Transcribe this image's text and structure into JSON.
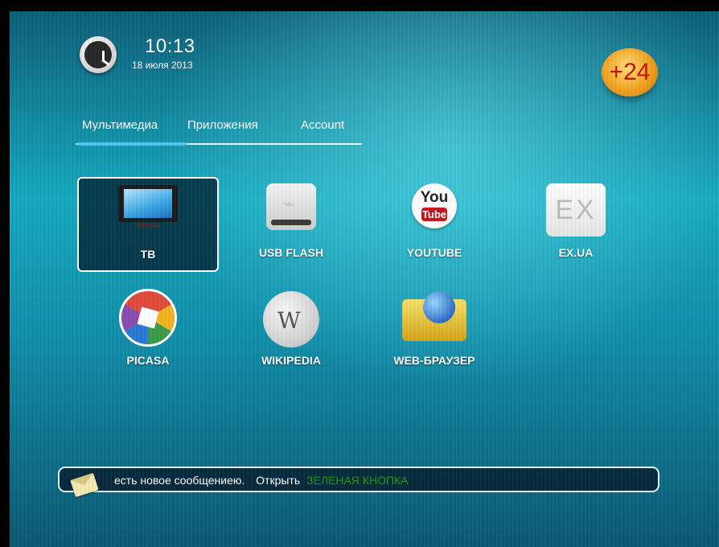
{
  "header": {
    "time": "10:13",
    "date": "18 июля 2013",
    "badge": "+24"
  },
  "tabs": [
    {
      "label": "Мультимедиа",
      "active": true
    },
    {
      "label": "Приложения",
      "active": false
    },
    {
      "label": "Account",
      "active": false
    }
  ],
  "apps": [
    {
      "label": "ТВ",
      "icon": "tv-icon",
      "selected": true
    },
    {
      "label": "USB FLASH",
      "icon": "usb-flash-icon"
    },
    {
      "label": "YOUTUBE",
      "icon": "youtube-icon",
      "icon_text_top": "You",
      "icon_text_bottom": "Tube"
    },
    {
      "label": "EX.UA",
      "icon": "ex-ua-icon",
      "icon_text": "EX"
    },
    {
      "label": "PICASA",
      "icon": "picasa-icon"
    },
    {
      "label": "WIKIPEDIA",
      "icon": "wikipedia-icon"
    },
    {
      "label": "WEB-БРАУЗЕР",
      "icon": "web-browser-icon"
    }
  ],
  "message": {
    "text": "есть новое сообщениею.",
    "action": "Открыть",
    "hint": "ЗЕЛЕНАЯ КНОПКА",
    "hint_color": "#1e9a12"
  },
  "colors": {
    "accent": "#4fc6ee",
    "badge_text": "#c21212"
  }
}
